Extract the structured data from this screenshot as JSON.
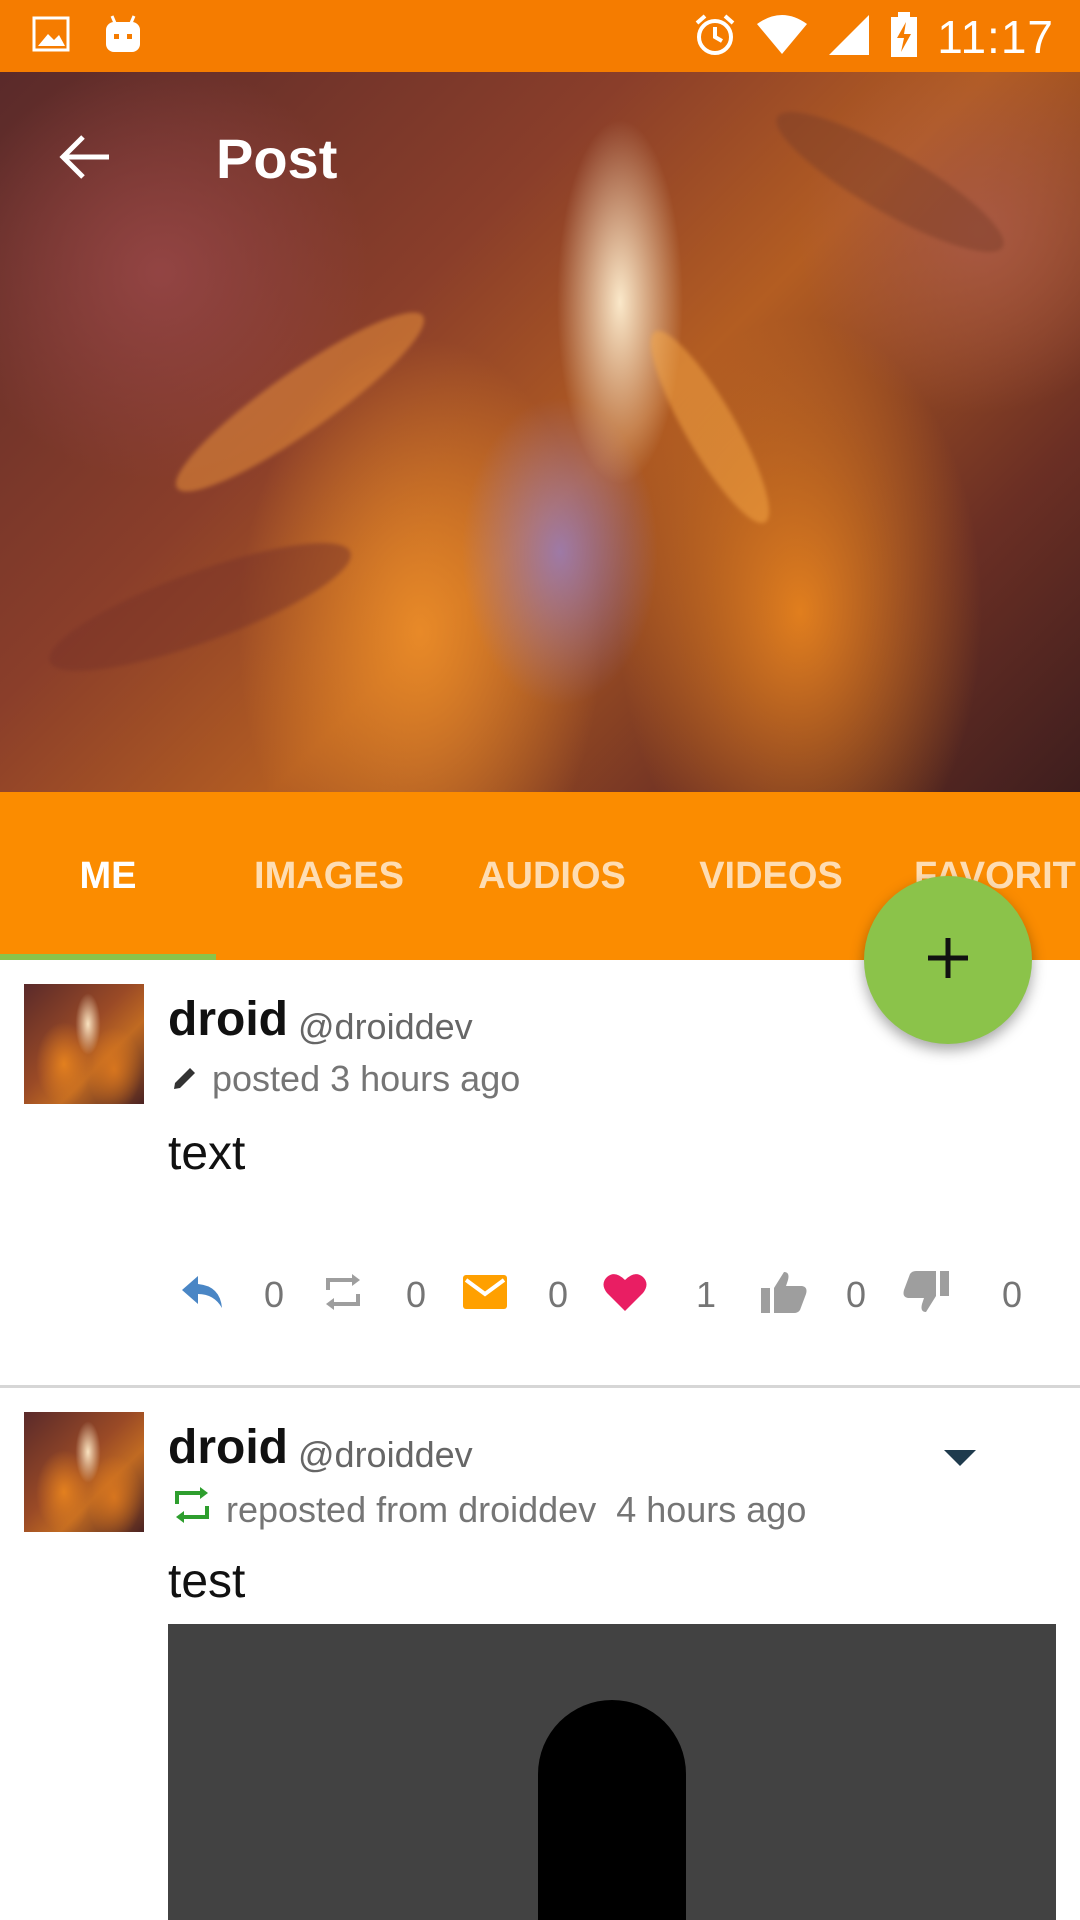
{
  "status_bar": {
    "time": "11:17",
    "left_icons": [
      "image-icon",
      "android-icon"
    ],
    "right_icons": [
      "alarm-icon",
      "wifi-icon",
      "signal-icon",
      "battery-charging-icon"
    ]
  },
  "header": {
    "title": "Post",
    "back_icon": "arrow-back-icon"
  },
  "tabs": [
    {
      "label": "ME",
      "active": true
    },
    {
      "label": "IMAGES",
      "active": false
    },
    {
      "label": "AUDIOS",
      "active": false
    },
    {
      "label": "VIDEOS",
      "active": false
    },
    {
      "label": "FAVORIT",
      "active": false
    }
  ],
  "fab": {
    "icon": "plus-icon"
  },
  "posts": [
    {
      "name": "droid",
      "handle": "@droiddev",
      "meta_icon": "pencil-icon",
      "meta_text": "posted 3 hours ago",
      "body": "text",
      "actions": [
        {
          "icon": "reply-icon",
          "count": "0",
          "color": "#4A86C5"
        },
        {
          "icon": "repost-icon",
          "count": "0",
          "color": "#9E9E9E"
        },
        {
          "icon": "mail-icon",
          "count": "0",
          "color": "#FFA000"
        },
        {
          "icon": "heart-icon",
          "count": "1",
          "color": "#E91E63"
        },
        {
          "icon": "thumb-up-icon",
          "count": "0",
          "color": "#9E9E9E"
        },
        {
          "icon": "thumb-down-icon",
          "count": "0",
          "color": "#9E9E9E"
        }
      ]
    },
    {
      "name": "droid",
      "handle": "@droiddev",
      "meta_icon": "repost-icon",
      "meta_text": "reposted from droiddev",
      "meta_time": "4 hours ago",
      "body": "test",
      "menu_icon": "chevron-down-icon"
    }
  ],
  "colors": {
    "status_bar": "#F57C00",
    "tab_bar": "#FB8C00",
    "fab": "#8BC34A",
    "indicator": "#8BC34A",
    "repost_green": "#2E9E2E"
  }
}
